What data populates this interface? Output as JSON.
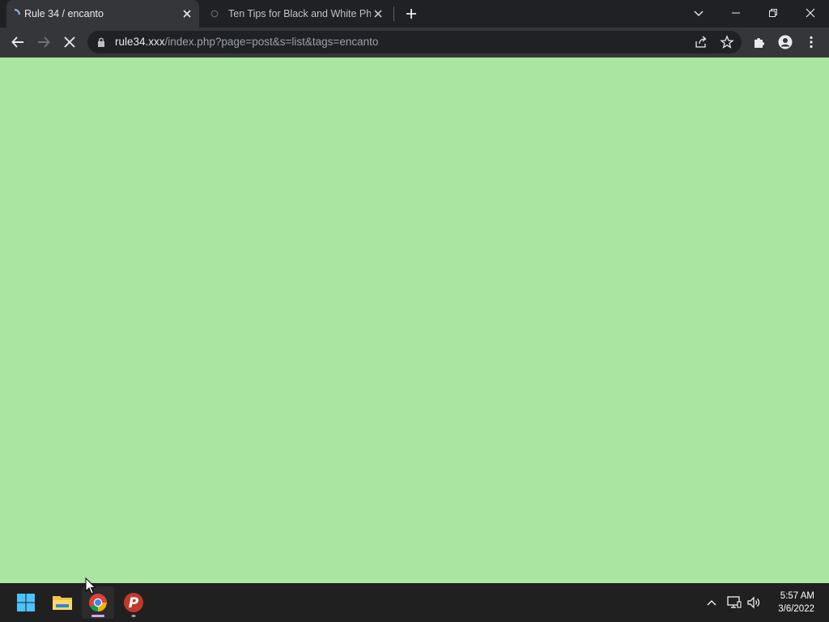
{
  "browser": {
    "tabs": [
      {
        "title": "Rule 34 / encanto",
        "active": true
      },
      {
        "title": "Ten Tips for Black and White Photography",
        "active": false
      }
    ],
    "url": {
      "host": "rule34.xxx",
      "path": "/index.php?page=post&s=list&tags=encanto"
    },
    "page_background": "#aae5a2"
  },
  "taskbar": {
    "apps": [
      {
        "name": "Start"
      },
      {
        "name": "File Explorer"
      },
      {
        "name": "Google Chrome",
        "active": true
      },
      {
        "name": "Psiphon"
      }
    ],
    "clock": {
      "time": "5:57 AM",
      "date": "3/6/2022"
    }
  }
}
